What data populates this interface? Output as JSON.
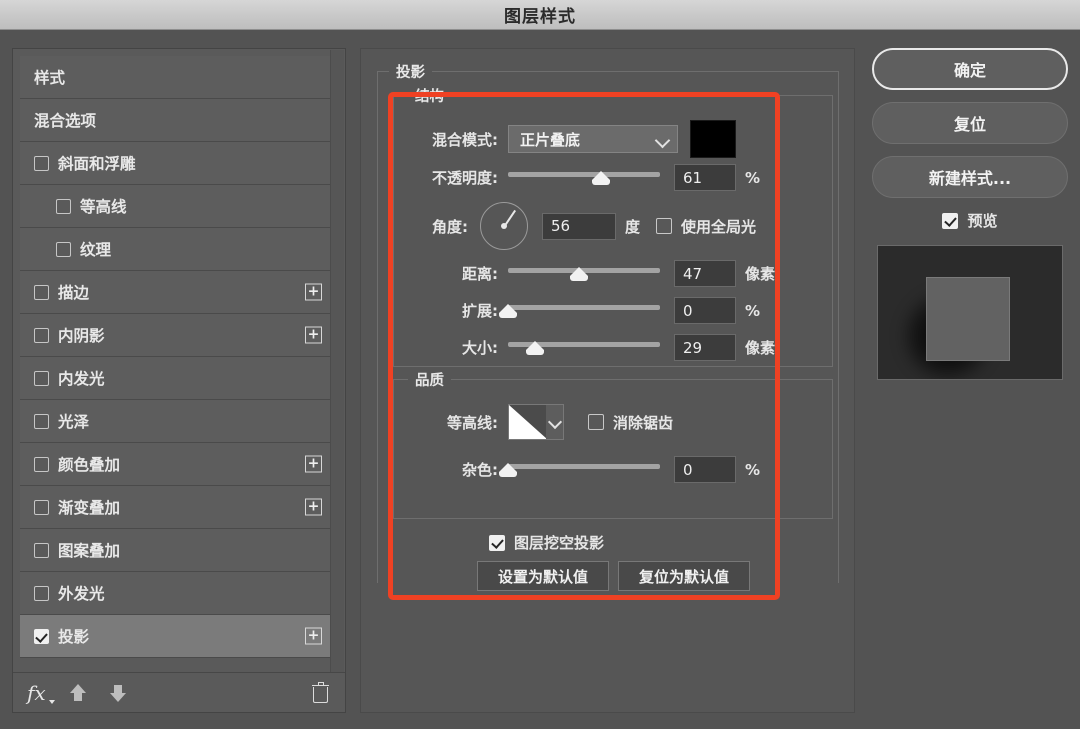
{
  "window": {
    "title": "图层样式"
  },
  "sidebar": {
    "items": [
      {
        "label": "样式",
        "checkbox": "none",
        "indent": false,
        "plus": false,
        "selected": false
      },
      {
        "label": "混合选项",
        "checkbox": "none",
        "indent": false,
        "plus": false,
        "selected": false
      },
      {
        "label": "斜面和浮雕",
        "checkbox": "unchecked",
        "indent": false,
        "plus": false,
        "selected": false
      },
      {
        "label": "等高线",
        "checkbox": "unchecked",
        "indent": true,
        "plus": false,
        "selected": false
      },
      {
        "label": "纹理",
        "checkbox": "unchecked",
        "indent": true,
        "plus": false,
        "selected": false
      },
      {
        "label": "描边",
        "checkbox": "unchecked",
        "indent": false,
        "plus": true,
        "selected": false
      },
      {
        "label": "内阴影",
        "checkbox": "unchecked",
        "indent": false,
        "plus": true,
        "selected": false
      },
      {
        "label": "内发光",
        "checkbox": "unchecked",
        "indent": false,
        "plus": false,
        "selected": false
      },
      {
        "label": "光泽",
        "checkbox": "unchecked",
        "indent": false,
        "plus": false,
        "selected": false
      },
      {
        "label": "颜色叠加",
        "checkbox": "unchecked",
        "indent": false,
        "plus": true,
        "selected": false
      },
      {
        "label": "渐变叠加",
        "checkbox": "unchecked",
        "indent": false,
        "plus": true,
        "selected": false
      },
      {
        "label": "图案叠加",
        "checkbox": "unchecked",
        "indent": false,
        "plus": false,
        "selected": false
      },
      {
        "label": "外发光",
        "checkbox": "unchecked",
        "indent": false,
        "plus": false,
        "selected": false
      },
      {
        "label": "投影",
        "checkbox": "checked",
        "indent": false,
        "plus": true,
        "selected": true
      }
    ],
    "footer": {
      "fx_label": "fx",
      "move_up_icon": "arrow-up-icon",
      "move_down_icon": "arrow-down-icon",
      "delete_icon": "trash-icon"
    }
  },
  "main": {
    "group_title": "投影",
    "structure": {
      "caption": "结构",
      "blend_mode": {
        "label": "混合模式:",
        "value": "正片叠底",
        "color": "#000000"
      },
      "opacity": {
        "label": "不透明度:",
        "value": "61",
        "unit": "%",
        "percent": 61
      },
      "angle": {
        "label": "角度:",
        "value": "56",
        "unit": "度",
        "degrees": 56,
        "use_global_light": {
          "label": "使用全局光",
          "checked": false
        }
      },
      "distance": {
        "label": "距离:",
        "value": "47",
        "unit": "像素",
        "percent": 47
      },
      "spread": {
        "label": "扩展:",
        "value": "0",
        "unit": "%",
        "percent": 0
      },
      "size": {
        "label": "大小:",
        "value": "29",
        "unit": "像素",
        "percent": 18
      }
    },
    "quality": {
      "caption": "品质",
      "contour": {
        "label": "等高线:",
        "anti_alias": {
          "label": "消除锯齿",
          "checked": false
        }
      },
      "noise": {
        "label": "杂色:",
        "value": "0",
        "unit": "%",
        "percent": 0
      }
    },
    "layer_knocks_out": {
      "label": "图层挖空投影",
      "checked": true
    },
    "set_default_label": "设置为默认值",
    "reset_default_label": "复位为默认值"
  },
  "right": {
    "ok_label": "确定",
    "reset_label": "复位",
    "new_style_label": "新建样式...",
    "preview": {
      "label": "预览",
      "checked": true
    }
  },
  "annotation": {
    "highlight_color": "#ef4123"
  }
}
